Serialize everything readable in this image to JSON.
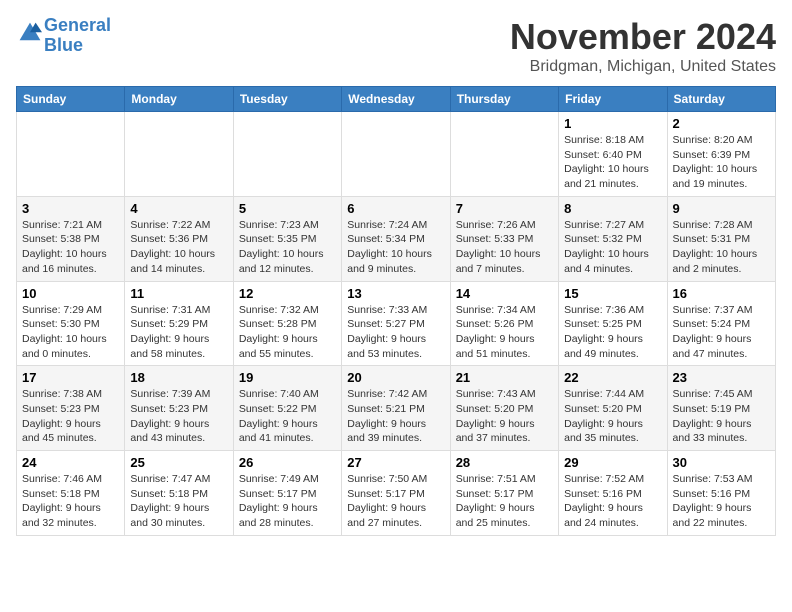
{
  "header": {
    "logo_line1": "General",
    "logo_line2": "Blue",
    "month_title": "November 2024",
    "location": "Bridgman, Michigan, United States"
  },
  "weekdays": [
    "Sunday",
    "Monday",
    "Tuesday",
    "Wednesday",
    "Thursday",
    "Friday",
    "Saturday"
  ],
  "weeks": [
    [
      {
        "day": "",
        "info": ""
      },
      {
        "day": "",
        "info": ""
      },
      {
        "day": "",
        "info": ""
      },
      {
        "day": "",
        "info": ""
      },
      {
        "day": "",
        "info": ""
      },
      {
        "day": "1",
        "info": "Sunrise: 8:18 AM\nSunset: 6:40 PM\nDaylight: 10 hours and 21 minutes."
      },
      {
        "day": "2",
        "info": "Sunrise: 8:20 AM\nSunset: 6:39 PM\nDaylight: 10 hours and 19 minutes."
      }
    ],
    [
      {
        "day": "3",
        "info": "Sunrise: 7:21 AM\nSunset: 5:38 PM\nDaylight: 10 hours and 16 minutes."
      },
      {
        "day": "4",
        "info": "Sunrise: 7:22 AM\nSunset: 5:36 PM\nDaylight: 10 hours and 14 minutes."
      },
      {
        "day": "5",
        "info": "Sunrise: 7:23 AM\nSunset: 5:35 PM\nDaylight: 10 hours and 12 minutes."
      },
      {
        "day": "6",
        "info": "Sunrise: 7:24 AM\nSunset: 5:34 PM\nDaylight: 10 hours and 9 minutes."
      },
      {
        "day": "7",
        "info": "Sunrise: 7:26 AM\nSunset: 5:33 PM\nDaylight: 10 hours and 7 minutes."
      },
      {
        "day": "8",
        "info": "Sunrise: 7:27 AM\nSunset: 5:32 PM\nDaylight: 10 hours and 4 minutes."
      },
      {
        "day": "9",
        "info": "Sunrise: 7:28 AM\nSunset: 5:31 PM\nDaylight: 10 hours and 2 minutes."
      }
    ],
    [
      {
        "day": "10",
        "info": "Sunrise: 7:29 AM\nSunset: 5:30 PM\nDaylight: 10 hours and 0 minutes."
      },
      {
        "day": "11",
        "info": "Sunrise: 7:31 AM\nSunset: 5:29 PM\nDaylight: 9 hours and 58 minutes."
      },
      {
        "day": "12",
        "info": "Sunrise: 7:32 AM\nSunset: 5:28 PM\nDaylight: 9 hours and 55 minutes."
      },
      {
        "day": "13",
        "info": "Sunrise: 7:33 AM\nSunset: 5:27 PM\nDaylight: 9 hours and 53 minutes."
      },
      {
        "day": "14",
        "info": "Sunrise: 7:34 AM\nSunset: 5:26 PM\nDaylight: 9 hours and 51 minutes."
      },
      {
        "day": "15",
        "info": "Sunrise: 7:36 AM\nSunset: 5:25 PM\nDaylight: 9 hours and 49 minutes."
      },
      {
        "day": "16",
        "info": "Sunrise: 7:37 AM\nSunset: 5:24 PM\nDaylight: 9 hours and 47 minutes."
      }
    ],
    [
      {
        "day": "17",
        "info": "Sunrise: 7:38 AM\nSunset: 5:23 PM\nDaylight: 9 hours and 45 minutes."
      },
      {
        "day": "18",
        "info": "Sunrise: 7:39 AM\nSunset: 5:23 PM\nDaylight: 9 hours and 43 minutes."
      },
      {
        "day": "19",
        "info": "Sunrise: 7:40 AM\nSunset: 5:22 PM\nDaylight: 9 hours and 41 minutes."
      },
      {
        "day": "20",
        "info": "Sunrise: 7:42 AM\nSunset: 5:21 PM\nDaylight: 9 hours and 39 minutes."
      },
      {
        "day": "21",
        "info": "Sunrise: 7:43 AM\nSunset: 5:20 PM\nDaylight: 9 hours and 37 minutes."
      },
      {
        "day": "22",
        "info": "Sunrise: 7:44 AM\nSunset: 5:20 PM\nDaylight: 9 hours and 35 minutes."
      },
      {
        "day": "23",
        "info": "Sunrise: 7:45 AM\nSunset: 5:19 PM\nDaylight: 9 hours and 33 minutes."
      }
    ],
    [
      {
        "day": "24",
        "info": "Sunrise: 7:46 AM\nSunset: 5:18 PM\nDaylight: 9 hours and 32 minutes."
      },
      {
        "day": "25",
        "info": "Sunrise: 7:47 AM\nSunset: 5:18 PM\nDaylight: 9 hours and 30 minutes."
      },
      {
        "day": "26",
        "info": "Sunrise: 7:49 AM\nSunset: 5:17 PM\nDaylight: 9 hours and 28 minutes."
      },
      {
        "day": "27",
        "info": "Sunrise: 7:50 AM\nSunset: 5:17 PM\nDaylight: 9 hours and 27 minutes."
      },
      {
        "day": "28",
        "info": "Sunrise: 7:51 AM\nSunset: 5:17 PM\nDaylight: 9 hours and 25 minutes."
      },
      {
        "day": "29",
        "info": "Sunrise: 7:52 AM\nSunset: 5:16 PM\nDaylight: 9 hours and 24 minutes."
      },
      {
        "day": "30",
        "info": "Sunrise: 7:53 AM\nSunset: 5:16 PM\nDaylight: 9 hours and 22 minutes."
      }
    ]
  ]
}
